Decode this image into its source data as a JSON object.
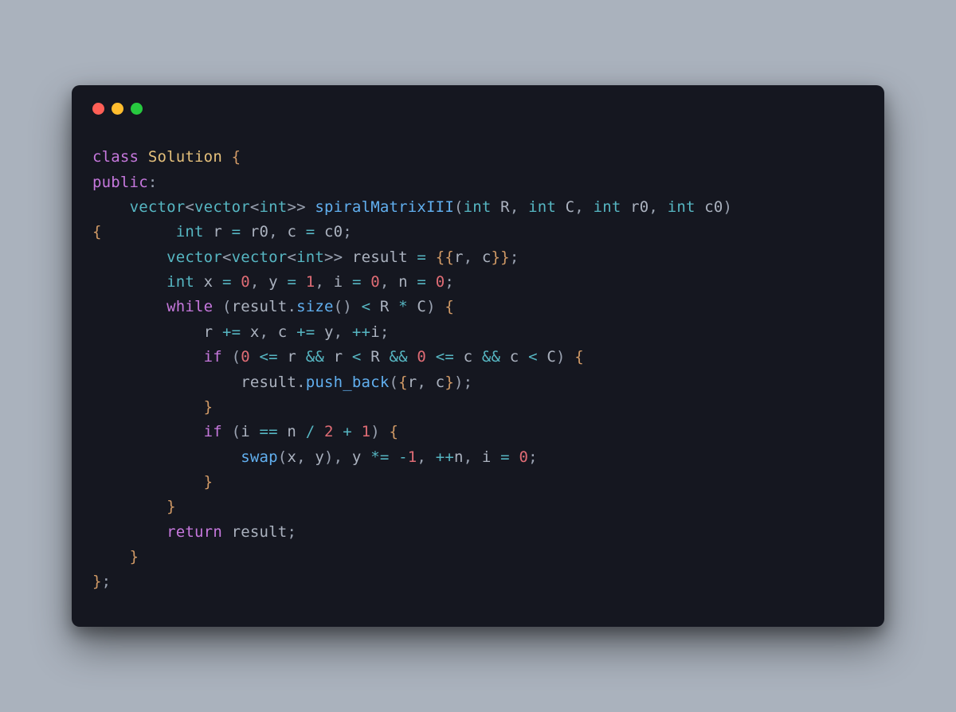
{
  "traffic_lights": {
    "red": "#ff5f56",
    "yellow": "#ffbd2e",
    "green": "#27c93f"
  },
  "code": {
    "tokens": [
      [
        [
          "k",
          "class"
        ],
        [
          "v",
          " "
        ],
        [
          "id",
          "Solution"
        ],
        [
          "v",
          " "
        ],
        [
          "br",
          "{"
        ]
      ],
      [
        [
          "k",
          "public"
        ],
        [
          "p",
          ":"
        ]
      ],
      [
        [
          "v",
          "    "
        ],
        [
          "t",
          "vector"
        ],
        [
          "p",
          "<"
        ],
        [
          "t",
          "vector"
        ],
        [
          "p",
          "<"
        ],
        [
          "t",
          "int"
        ],
        [
          "p",
          ">>"
        ],
        [
          "v",
          " "
        ],
        [
          "fn",
          "spiralMatrixIII"
        ],
        [
          "p",
          "("
        ],
        [
          "t",
          "int"
        ],
        [
          "v",
          " R"
        ],
        [
          "p",
          ","
        ],
        [
          "v",
          " "
        ],
        [
          "t",
          "int"
        ],
        [
          "v",
          " C"
        ],
        [
          "p",
          ","
        ],
        [
          "v",
          " "
        ],
        [
          "t",
          "int"
        ],
        [
          "v",
          " r0"
        ],
        [
          "p",
          ","
        ],
        [
          "v",
          " "
        ],
        [
          "t",
          "int"
        ],
        [
          "v",
          " c0"
        ],
        [
          "p",
          ")"
        ]
      ],
      [
        [
          "br",
          "{"
        ],
        [
          "v",
          "        "
        ],
        [
          "t",
          "int"
        ],
        [
          "v",
          " r "
        ],
        [
          "op",
          "="
        ],
        [
          "v",
          " r0"
        ],
        [
          "p",
          ","
        ],
        [
          "v",
          " c "
        ],
        [
          "op",
          "="
        ],
        [
          "v",
          " c0"
        ],
        [
          "p",
          ";"
        ]
      ],
      [
        [
          "v",
          "        "
        ],
        [
          "t",
          "vector"
        ],
        [
          "p",
          "<"
        ],
        [
          "t",
          "vector"
        ],
        [
          "p",
          "<"
        ],
        [
          "t",
          "int"
        ],
        [
          "p",
          ">>"
        ],
        [
          "v",
          " result "
        ],
        [
          "op",
          "="
        ],
        [
          "v",
          " "
        ],
        [
          "br",
          "{{"
        ],
        [
          "v",
          "r"
        ],
        [
          "p",
          ","
        ],
        [
          "v",
          " c"
        ],
        [
          "br",
          "}}"
        ],
        [
          "p",
          ";"
        ]
      ],
      [
        [
          "v",
          "        "
        ],
        [
          "t",
          "int"
        ],
        [
          "v",
          " x "
        ],
        [
          "op",
          "="
        ],
        [
          "v",
          " "
        ],
        [
          "num",
          "0"
        ],
        [
          "p",
          ","
        ],
        [
          "v",
          " y "
        ],
        [
          "op",
          "="
        ],
        [
          "v",
          " "
        ],
        [
          "num",
          "1"
        ],
        [
          "p",
          ","
        ],
        [
          "v",
          " i "
        ],
        [
          "op",
          "="
        ],
        [
          "v",
          " "
        ],
        [
          "num",
          "0"
        ],
        [
          "p",
          ","
        ],
        [
          "v",
          " n "
        ],
        [
          "op",
          "="
        ],
        [
          "v",
          " "
        ],
        [
          "num",
          "0"
        ],
        [
          "p",
          ";"
        ]
      ],
      [
        [
          "v",
          "        "
        ],
        [
          "k",
          "while"
        ],
        [
          "v",
          " "
        ],
        [
          "p",
          "("
        ],
        [
          "v",
          "result"
        ],
        [
          "p",
          "."
        ],
        [
          "fn",
          "size"
        ],
        [
          "p",
          "()"
        ],
        [
          "v",
          " "
        ],
        [
          "op",
          "<"
        ],
        [
          "v",
          " R "
        ],
        [
          "op",
          "*"
        ],
        [
          "v",
          " C"
        ],
        [
          "p",
          ")"
        ],
        [
          "v",
          " "
        ],
        [
          "br",
          "{"
        ]
      ],
      [
        [
          "v",
          "            r "
        ],
        [
          "op",
          "+="
        ],
        [
          "v",
          " x"
        ],
        [
          "p",
          ","
        ],
        [
          "v",
          " c "
        ],
        [
          "op",
          "+="
        ],
        [
          "v",
          " y"
        ],
        [
          "p",
          ","
        ],
        [
          "v",
          " "
        ],
        [
          "op",
          "++"
        ],
        [
          "v",
          "i"
        ],
        [
          "p",
          ";"
        ]
      ],
      [
        [
          "v",
          "            "
        ],
        [
          "k",
          "if"
        ],
        [
          "v",
          " "
        ],
        [
          "p",
          "("
        ],
        [
          "num",
          "0"
        ],
        [
          "v",
          " "
        ],
        [
          "op",
          "<="
        ],
        [
          "v",
          " r "
        ],
        [
          "op",
          "&&"
        ],
        [
          "v",
          " r "
        ],
        [
          "op",
          "<"
        ],
        [
          "v",
          " R "
        ],
        [
          "op",
          "&&"
        ],
        [
          "v",
          " "
        ],
        [
          "num",
          "0"
        ],
        [
          "v",
          " "
        ],
        [
          "op",
          "<="
        ],
        [
          "v",
          " c "
        ],
        [
          "op",
          "&&"
        ],
        [
          "v",
          " c "
        ],
        [
          "op",
          "<"
        ],
        [
          "v",
          " C"
        ],
        [
          "p",
          ")"
        ],
        [
          "v",
          " "
        ],
        [
          "br",
          "{"
        ]
      ],
      [
        [
          "v",
          "                result"
        ],
        [
          "p",
          "."
        ],
        [
          "fn",
          "push_back"
        ],
        [
          "p",
          "("
        ],
        [
          "br",
          "{"
        ],
        [
          "v",
          "r"
        ],
        [
          "p",
          ","
        ],
        [
          "v",
          " c"
        ],
        [
          "br",
          "}"
        ],
        [
          "p",
          ")"
        ],
        [
          "p",
          ";"
        ]
      ],
      [
        [
          "v",
          "            "
        ],
        [
          "br",
          "}"
        ]
      ],
      [
        [
          "v",
          "            "
        ],
        [
          "k",
          "if"
        ],
        [
          "v",
          " "
        ],
        [
          "p",
          "("
        ],
        [
          "v",
          "i "
        ],
        [
          "op",
          "=="
        ],
        [
          "v",
          " n "
        ],
        [
          "op",
          "/"
        ],
        [
          "v",
          " "
        ],
        [
          "num",
          "2"
        ],
        [
          "v",
          " "
        ],
        [
          "op",
          "+"
        ],
        [
          "v",
          " "
        ],
        [
          "num",
          "1"
        ],
        [
          "p",
          ")"
        ],
        [
          "v",
          " "
        ],
        [
          "br",
          "{"
        ]
      ],
      [
        [
          "v",
          "                "
        ],
        [
          "fn",
          "swap"
        ],
        [
          "p",
          "("
        ],
        [
          "v",
          "x"
        ],
        [
          "p",
          ","
        ],
        [
          "v",
          " y"
        ],
        [
          "p",
          ")"
        ],
        [
          "p",
          ","
        ],
        [
          "v",
          " y "
        ],
        [
          "op",
          "*="
        ],
        [
          "v",
          " "
        ],
        [
          "op",
          "-"
        ],
        [
          "num",
          "1"
        ],
        [
          "p",
          ","
        ],
        [
          "v",
          " "
        ],
        [
          "op",
          "++"
        ],
        [
          "v",
          "n"
        ],
        [
          "p",
          ","
        ],
        [
          "v",
          " i "
        ],
        [
          "op",
          "="
        ],
        [
          "v",
          " "
        ],
        [
          "num",
          "0"
        ],
        [
          "p",
          ";"
        ]
      ],
      [
        [
          "v",
          "            "
        ],
        [
          "br",
          "}"
        ]
      ],
      [
        [
          "v",
          "        "
        ],
        [
          "br",
          "}"
        ]
      ],
      [
        [
          "v",
          "        "
        ],
        [
          "k",
          "return"
        ],
        [
          "v",
          " result"
        ],
        [
          "p",
          ";"
        ]
      ],
      [
        [
          "v",
          "    "
        ],
        [
          "br",
          "}"
        ]
      ],
      [
        [
          "br",
          "}"
        ],
        [
          "p",
          ";"
        ]
      ]
    ]
  }
}
